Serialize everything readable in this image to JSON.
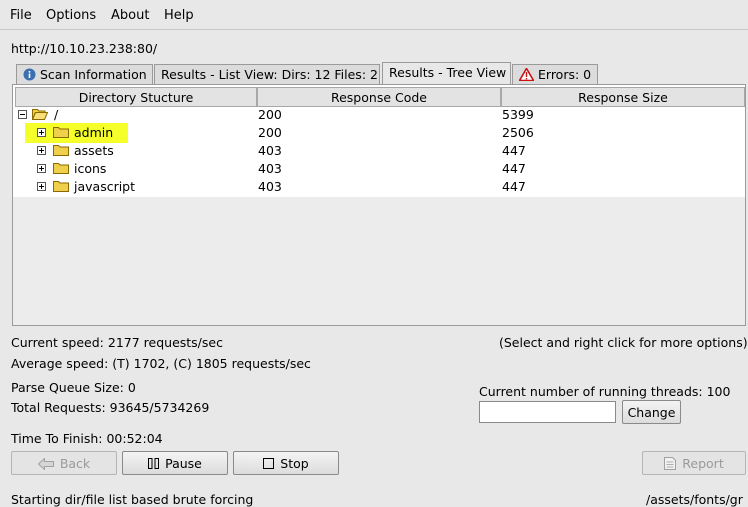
{
  "menu": {
    "file": "File",
    "options": "Options",
    "about": "About",
    "help": "Help"
  },
  "target_url": "http://10.10.23.238:80/",
  "tabs": {
    "scan_info": "Scan Information",
    "list_view": "Results - List View: Dirs: 12 Files: 2",
    "tree_view": "Results - Tree View",
    "errors": "Errors: 0"
  },
  "table": {
    "headers": {
      "dir": "Directory Stucture",
      "code": "Response Code",
      "size": "Response Size"
    },
    "rows": [
      {
        "name": "/",
        "code": "200",
        "size": "5399"
      },
      {
        "name": "admin",
        "code": "200",
        "size": "2506"
      },
      {
        "name": "assets",
        "code": "403",
        "size": "447"
      },
      {
        "name": "icons",
        "code": "403",
        "size": "447"
      },
      {
        "name": "javascript",
        "code": "403",
        "size": "447"
      }
    ]
  },
  "stats": {
    "current_speed": "Current speed: 2177 requests/sec",
    "hint": "(Select and right click for more options)",
    "average_speed": "Average speed: (T) 1702, (C) 1805 requests/sec",
    "parse_queue": "Parse Queue Size: 0",
    "threads_label": "Current number of running threads: 100",
    "total_requests": "Total Requests: 93645/5734269",
    "time_to_finish": "Time To Finish: 00:52:04"
  },
  "threads_input": {
    "value": ""
  },
  "buttons": {
    "change": "Change",
    "back": "Back",
    "pause": "Pause",
    "stop": "Stop",
    "report": "Report"
  },
  "status": {
    "left": "Starting dir/file list based brute forcing",
    "right": "/assets/fonts/gr"
  },
  "colors": {
    "highlight": "#f5ff2a",
    "folder": "#f0d04a",
    "error_icon": "#cc1111",
    "info_icon": "#3a6fb0"
  }
}
